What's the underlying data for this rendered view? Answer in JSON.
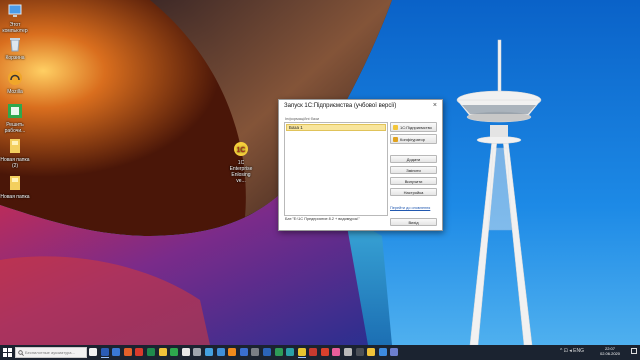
{
  "desktop": {
    "icons": [
      {
        "label": "Этот компьютер",
        "icon": "computer-icon"
      },
      {
        "label": "Корзина",
        "icon": "recycle-bin-icon"
      },
      {
        "label": "Mozilla",
        "icon": "headphones-app-icon"
      },
      {
        "label": "Решить рабочи...",
        "icon": "green-app-icon"
      },
      {
        "label": "Новая папка (2)",
        "icon": "folder-icon"
      },
      {
        "label": "Новая папка",
        "icon": "folder-icon"
      },
      {
        "label": "1С Enterprise Enlosing ve...",
        "icon": "1c-enterprise-icon"
      }
    ]
  },
  "dialog": {
    "title": "Запуск 1С:Підприємства (учбової версії)",
    "close_glyph": "×",
    "infobases_label": "Інформаційні бази",
    "infobases": [
      "База 1"
    ],
    "selected_infobase": "База 1",
    "path": "Бат:\"E:\\1С Предприятие 8.2 + видимурок\\\"",
    "buttons": {
      "enterprise": "1С:Підприємство",
      "designer": "Конфігуратор",
      "add": "Додати",
      "change": "Змінити",
      "delete": "Вилучити",
      "settings": "Настройка",
      "exit": "Вихід"
    },
    "updates_link": "Перейти до оновлення"
  },
  "taskbar": {
    "search_placeholder": "Беспилотные аукзиатура...",
    "apps": [
      {
        "icon": "notepad-icon",
        "color": "#f2f2f2"
      },
      {
        "icon": "word-icon",
        "color": "#2b5cb5"
      },
      {
        "icon": "store-icon",
        "color": "#3a78d4"
      },
      {
        "icon": "firefox-icon",
        "color": "#e3612a"
      },
      {
        "icon": "yandex-icon",
        "color": "#d93a2c"
      },
      {
        "icon": "excel-icon",
        "color": "#1f8a4c"
      },
      {
        "icon": "explorer-icon",
        "color": "#f0c23a"
      },
      {
        "icon": "green-app-icon",
        "color": "#2ea84d"
      },
      {
        "icon": "chrome-icon",
        "color": "#e8e8e8"
      },
      {
        "icon": "settings-icon",
        "color": "#9fa5ad"
      },
      {
        "icon": "gallery-icon",
        "color": "#44a1e0"
      },
      {
        "icon": "play-icon",
        "color": "#3f8fd8"
      },
      {
        "icon": "vlc-icon",
        "color": "#f08a1c"
      },
      {
        "icon": "mail-icon",
        "color": "#3a6fd0"
      },
      {
        "icon": "camera-icon",
        "color": "#7a7f86"
      },
      {
        "icon": "r-app-icon",
        "color": "#2b64b8"
      },
      {
        "icon": "spreadsheet-icon",
        "color": "#2e9b57"
      },
      {
        "icon": "three-app-icon",
        "color": "#2aa0a8"
      },
      {
        "icon": "1c-enterprise-icon",
        "color": "#e8c530"
      },
      {
        "icon": "record-icon",
        "color": "#c73a2f"
      },
      {
        "icon": "pdf-icon",
        "color": "#d8402c"
      },
      {
        "icon": "paint-icon",
        "color": "#e85d9a"
      },
      {
        "icon": "eye-icon",
        "color": "#b9b9b9"
      },
      {
        "icon": "terminal-icon",
        "color": "#4a4f57"
      },
      {
        "icon": "folder-icon",
        "color": "#f0c23a"
      },
      {
        "icon": "browser-icon",
        "color": "#3d8be0"
      },
      {
        "icon": "vpn-icon",
        "color": "#6d7fcf"
      }
    ],
    "tray_text": "^ ⊡ ◂ ENG",
    "time": "22:07",
    "date": "02.06.2020"
  }
}
